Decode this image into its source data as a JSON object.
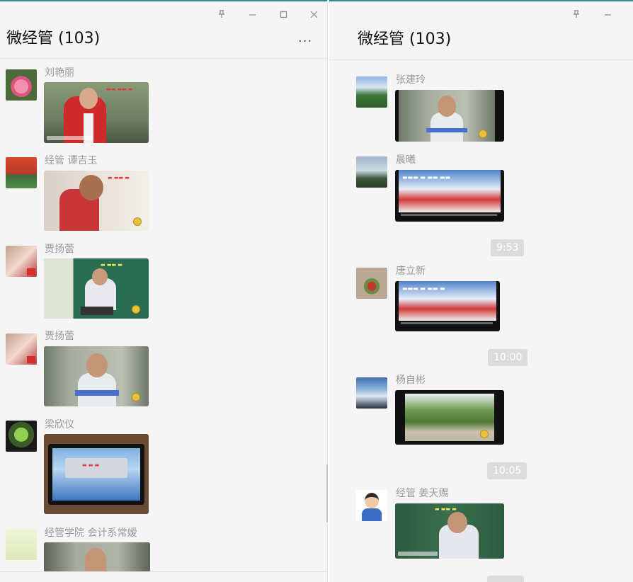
{
  "left": {
    "title": "微经管 (103)",
    "more_label": "...",
    "messages": [
      {
        "sender": "刘艳丽"
      },
      {
        "sender": "经管 谭吉玉"
      },
      {
        "sender": "贾扬蕾"
      },
      {
        "sender": "贾扬蕾"
      },
      {
        "sender": "梁欣仪"
      },
      {
        "sender": "经管学院 会计系常嫒"
      }
    ]
  },
  "right": {
    "title": "微经管 (103)",
    "messages": [
      {
        "sender": "张建玲"
      },
      {
        "sender": "晨曦"
      },
      {
        "sender": "唐立新"
      },
      {
        "sender": "杨自彬"
      },
      {
        "sender": "经管 姜天赐"
      }
    ],
    "times": [
      "9:53",
      "10:00",
      "10:05"
    ]
  },
  "colors": {
    "accent": "#2a8e88",
    "background": "#f5f5f5",
    "time_pill": "#dcdcdc"
  },
  "icons": [
    "pin-icon",
    "minimize-icon",
    "maximize-icon",
    "close-icon",
    "more-icon"
  ]
}
